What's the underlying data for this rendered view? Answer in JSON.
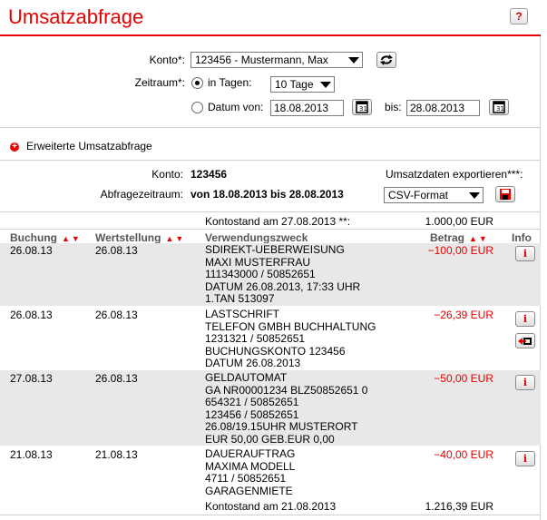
{
  "page": {
    "title": "Umsatzabfrage",
    "help": "?"
  },
  "form": {
    "konto_label": "Konto*:",
    "konto_value": "123456 - Mustermann, Max",
    "zeitraum_label": "Zeitraum*:",
    "in_tagen_label": "in Tagen:",
    "tage_value": "10 Tage",
    "datum_von_label": "Datum von:",
    "datum_von_value": "18.08.2013",
    "bis_label": "bis:",
    "bis_value": "28.08.2013",
    "radio_selected": "in_tagen"
  },
  "erweiterte": {
    "label": "Erweiterte Umsatzabfrage"
  },
  "summary": {
    "konto_label": "Konto:",
    "konto_value": "123456",
    "zeitraum_label": "Abfragezeitraum:",
    "zeitraum_value": "von 18.08.2013 bis 28.08.2013",
    "export_label": "Umsatzdaten exportieren***:",
    "export_format": "CSV-Format"
  },
  "kontostand_start": {
    "label": "Kontostand am 27.08.2013 **:",
    "value": "1.000,00 EUR"
  },
  "columns": {
    "buchung": "Buchung",
    "wertstellung": "Wertstellung",
    "verwendungszweck": "Verwendungszweck",
    "betrag": "Betrag",
    "info": "Info",
    "sort_arrows": "▲▼"
  },
  "transactions": [
    {
      "buchung": "26.08.13",
      "wertstellung": "26.08.13",
      "lines": [
        "SDIREKT-UEBERWEISUNG",
        "MAXI MUSTERFRAU",
        "111343000 / 50852651",
        "DATUM 26.08.2013, 17:33 UHR",
        "1.TAN 513097"
      ],
      "betrag": "−100,00 EUR"
    },
    {
      "buchung": "26.08.13",
      "wertstellung": "26.08.13",
      "lines": [
        "LASTSCHRIFT",
        "TELEFON GMBH BUCHHALTUNG",
        "1231321 / 50852651",
        "BUCHUNGSKONTO 123456",
        "DATUM 26.08.2013"
      ],
      "betrag": "−26,39 EUR"
    },
    {
      "buchung": "27.08.13",
      "wertstellung": "26.08.13",
      "lines": [
        "GELDAUTOMAT",
        "GA NR00001234 BLZ50852651 0",
        "654321 / 50852651",
        "123456 / 50852651",
        "26.08/19.15UHR MUSTERORT",
        "EUR 50,00 GEB.EUR 0,00"
      ],
      "betrag": "−50,00 EUR"
    },
    {
      "buchung": "21.08.13",
      "wertstellung": "21.08.13",
      "lines": [
        "DAUERAUFTRAG",
        "MAXIMA MODELL",
        "4711 / 50852651",
        "GARAGENMIETE"
      ],
      "betrag": "−40,00 EUR"
    }
  ],
  "kontostand_end": {
    "label": "Kontostand am 21.08.2013",
    "value": "1.216,39 EUR"
  },
  "icons": {
    "info": "i",
    "refresh": "refresh-icon",
    "calendar": "calendar-icon",
    "save": "save-icon",
    "dispute": "return-booking-icon"
  },
  "colors": {
    "brand_red": "#e60000",
    "row_shade": "#e8e8e8"
  }
}
